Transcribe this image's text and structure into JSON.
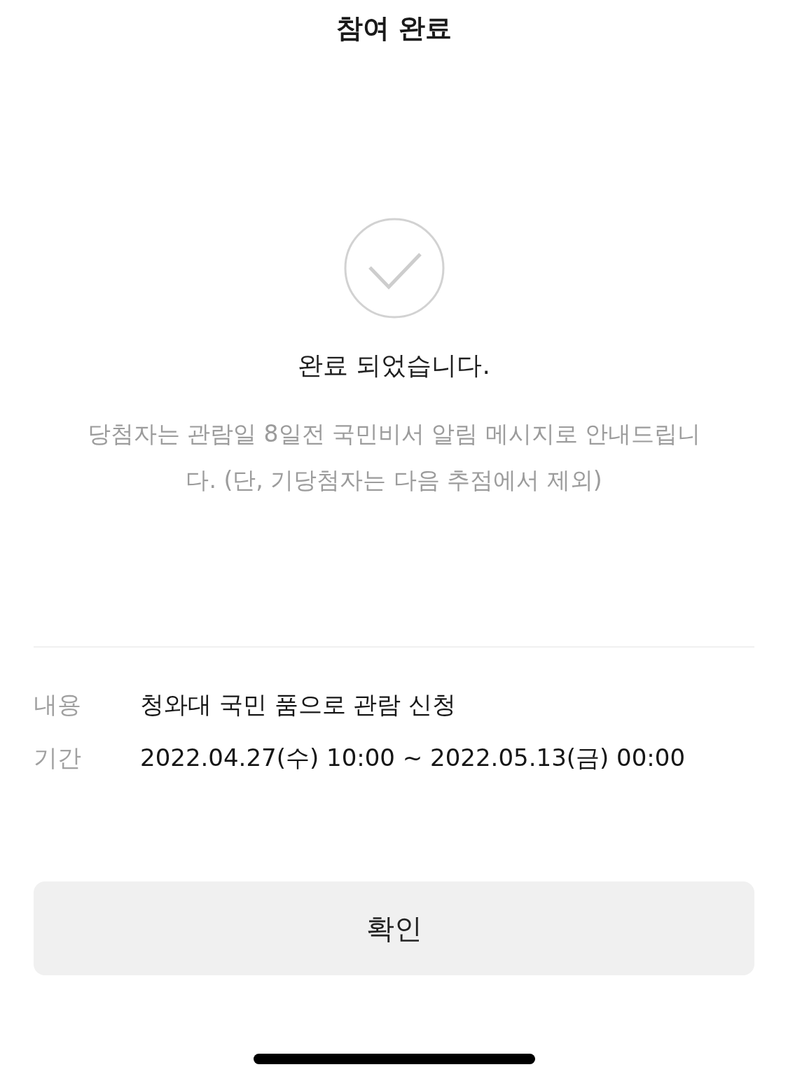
{
  "header": {
    "title": "참여 완료"
  },
  "result": {
    "message": "완료 되었습니다.",
    "notice": "당첨자는 관람일 8일전 국민비서 알림 메시지로 안내드립니다. (단, 기당첨자는 다음 추점에서 제외)"
  },
  "details": [
    {
      "label": "내용",
      "value": "청와대 국민 품으로 관람 신청"
    },
    {
      "label": "기간",
      "value": "2022.04.27(수) 10:00 ~ 2022.05.13(금) 00:00"
    }
  ],
  "buttons": [
    {
      "label": "확인"
    }
  ]
}
